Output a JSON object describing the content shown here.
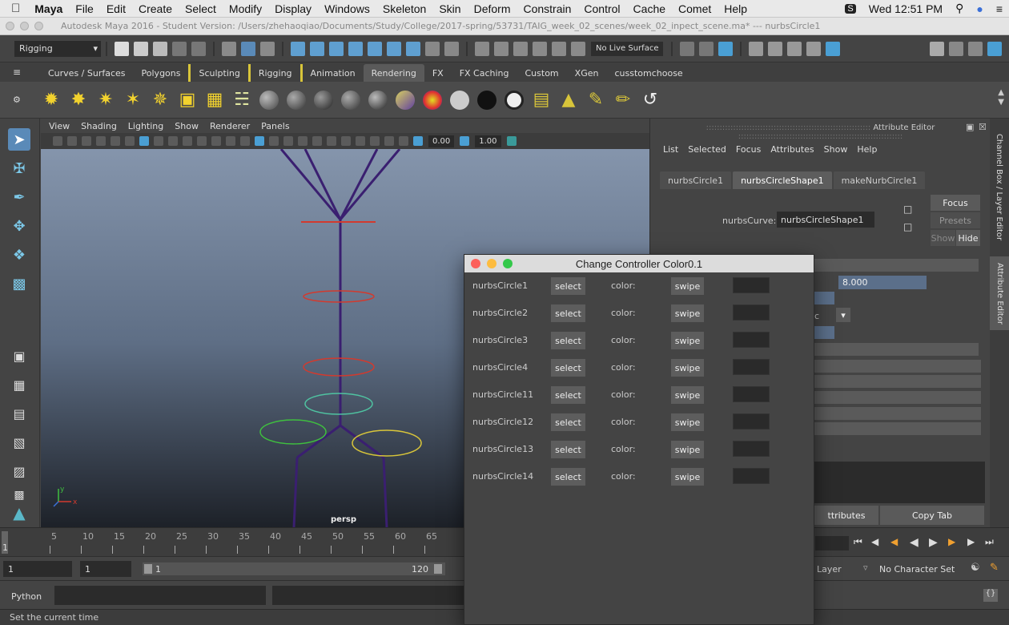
{
  "menubar": {
    "app": "Maya",
    "items": [
      "File",
      "Edit",
      "Create",
      "Select",
      "Modify",
      "Display",
      "Windows",
      "Skeleton",
      "Skin",
      "Deform",
      "Constrain",
      "Control",
      "Cache",
      "Comet",
      "Help"
    ],
    "clock": "Wed 12:51 PM"
  },
  "window": {
    "title": "Autodesk Maya 2016 - Student Version: /Users/zhehaoqiao/Documents/Study/College/2017-spring/53731/TAIG_week_02_scenes/week_02_inpect_scene.ma*   ---   nurbsCircle1"
  },
  "status_line": {
    "mode": "Rigging",
    "live_surface": "No Live Surface"
  },
  "shelf": {
    "tabs": [
      {
        "label": "Curves / Surfaces"
      },
      {
        "label": "Polygons"
      },
      {
        "label": "Sculpting"
      },
      {
        "label": "Rigging"
      },
      {
        "label": "Animation"
      },
      {
        "label": "Rendering",
        "active": true
      },
      {
        "label": "FX"
      },
      {
        "label": "FX Caching"
      },
      {
        "label": "Custom"
      },
      {
        "label": "XGen"
      },
      {
        "label": "cusstomchoose"
      }
    ]
  },
  "viewport": {
    "menu": [
      "View",
      "Shading",
      "Lighting",
      "Show",
      "Renderer",
      "Panels"
    ],
    "value_a": "0.00",
    "value_b": "1.00",
    "camera_label": "persp",
    "axis_y": "y",
    "axis_x": "x"
  },
  "attribute_editor": {
    "title": "Attribute Editor",
    "menu": [
      "List",
      "Selected",
      "Focus",
      "Attributes",
      "Show",
      "Help"
    ],
    "tabs": [
      {
        "label": "nurbsCircle1"
      },
      {
        "label": "nurbsCircleShape1",
        "active": true
      },
      {
        "label": "makeNurbCircle1"
      }
    ],
    "field_label": "nurbsCurve:",
    "field_value": "nurbsCircleShape1",
    "focus_label": "Focus",
    "presets_label": "Presets",
    "show_label": "Show",
    "hide_label": "Hide",
    "value": "8.000",
    "partial_c": "c",
    "attributes_btn": "ttributes",
    "copy_tab": "Copy Tab"
  },
  "side_tabs": {
    "channel_box": "Channel Box / Layer Editor",
    "attribute_editor": "Attribute Editor"
  },
  "timeline": {
    "ticks": [
      "5",
      "10",
      "15",
      "20",
      "25",
      "30",
      "35",
      "40",
      "45",
      "50",
      "55",
      "60",
      "65"
    ],
    "current": "1"
  },
  "range": {
    "start": "1",
    "start2": "1",
    "slider_start": "1",
    "slider_end": "120",
    "anim_layer": "Layer",
    "character_set": "No Character Set"
  },
  "command_line": {
    "language": "Python"
  },
  "help_line": {
    "text": "Set the current time"
  },
  "dialog": {
    "title": "Change Controller Color0.1",
    "select_label": "select",
    "color_label": "color:",
    "swipe_label": "swipe",
    "rows": [
      {
        "name": "nurbsCircle1"
      },
      {
        "name": "nurbsCircle2"
      },
      {
        "name": "nurbsCircle3"
      },
      {
        "name": "nurbsCircle4"
      },
      {
        "name": "nurbsCircle11"
      },
      {
        "name": "nurbsCircle12"
      },
      {
        "name": "nurbsCircle13"
      },
      {
        "name": "nurbsCircle14"
      }
    ],
    "swatch_color": "#2b2b2b"
  },
  "colors": {
    "accent_blue": "#4a9fd4",
    "circle_red": "#d23a2e",
    "circle_green": "#3fbf3f",
    "circle_teal": "#4fc3a1",
    "circle_yellow": "#d8c53a",
    "joint_purple": "#3a1f70"
  }
}
